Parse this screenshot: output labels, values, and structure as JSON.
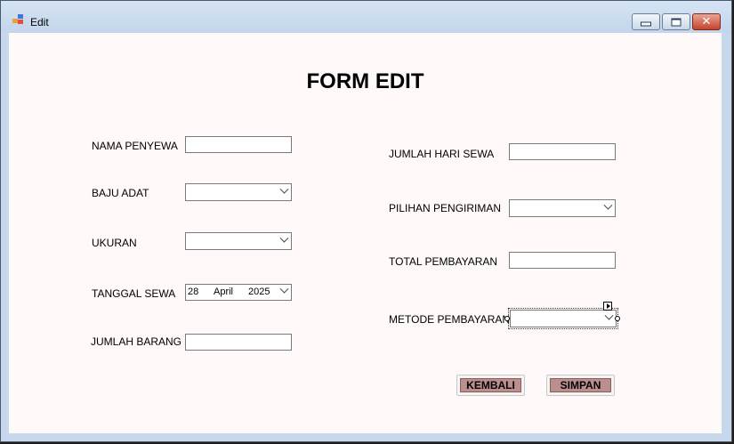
{
  "window": {
    "title": "Edit",
    "colors": {
      "frame": "#c7d8ec",
      "client": "#fff9f9",
      "button_fill": "#bc8f8f",
      "close_button": "#c4422c"
    },
    "controls": {
      "minimize_icon": "minimize-icon",
      "maximize_icon": "maximize-icon",
      "close_icon": "close-icon",
      "close_glyph": "✕"
    }
  },
  "form": {
    "heading": "FORM EDIT",
    "left": {
      "nama_penyewa": {
        "label": "NAMA PENYEWA",
        "value": ""
      },
      "baju_adat": {
        "label": "BAJU ADAT",
        "selected": ""
      },
      "ukuran": {
        "label": "UKURAN",
        "selected": ""
      },
      "tanggal_sewa": {
        "label": "TANGGAL SEWA",
        "day": "28",
        "month": "April",
        "year": "2025"
      },
      "jumlah_barang": {
        "label": "JUMLAH BARANG",
        "value": ""
      }
    },
    "right": {
      "jumlah_hari_sewa": {
        "label": "JUMLAH HARI SEWA",
        "value": ""
      },
      "pilihan_pengiriman": {
        "label": "PILIHAN PENGIRIMAN",
        "selected": ""
      },
      "total_pembayaran": {
        "label": "TOTAL PEMBAYARAN",
        "value": ""
      },
      "metode_pembayaran": {
        "label": "METODE PEMBAYARAN",
        "selected": ""
      }
    },
    "buttons": {
      "kembali": "KEMBALI",
      "simpan": "SIMPAN"
    }
  }
}
